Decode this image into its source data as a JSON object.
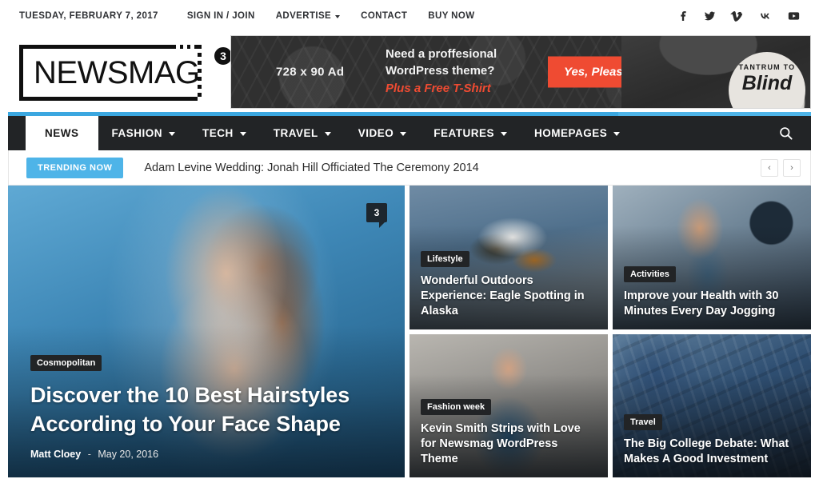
{
  "topbar": {
    "date": "TUESDAY, FEBRUARY 7, 2017",
    "menu": [
      {
        "label": "SIGN IN / JOIN",
        "has_caret": false
      },
      {
        "label": "ADVERTISE",
        "has_caret": true
      },
      {
        "label": "CONTACT",
        "has_caret": false
      },
      {
        "label": "BUY NOW",
        "has_caret": false
      }
    ],
    "social": [
      {
        "name": "facebook-icon"
      },
      {
        "name": "twitter-icon"
      },
      {
        "name": "vimeo-icon"
      },
      {
        "name": "vk-icon"
      },
      {
        "name": "youtube-icon"
      }
    ]
  },
  "logo": {
    "text": "NEWSMAG",
    "badge": "3"
  },
  "ad": {
    "size_label": "728 x 90 Ad",
    "line1": "Need a proffesional",
    "line2": "WordPress theme?",
    "line3": "Plus a Free T-Shirt",
    "cta": "Yes, Please",
    "shirt_line1": "TANTRUM TO",
    "shirt_line2": "Blind",
    "accent_color": "#ef4b32"
  },
  "nav": {
    "items": [
      {
        "label": "NEWS",
        "has_caret": false,
        "active": true
      },
      {
        "label": "FASHION",
        "has_caret": true,
        "active": false
      },
      {
        "label": "TECH",
        "has_caret": true,
        "active": false
      },
      {
        "label": "TRAVEL",
        "has_caret": true,
        "active": false
      },
      {
        "label": "VIDEO",
        "has_caret": true,
        "active": false
      },
      {
        "label": "FEATURES",
        "has_caret": true,
        "active": false
      },
      {
        "label": "HOMEPAGES",
        "has_caret": true,
        "active": false
      }
    ],
    "search_icon": "search-icon",
    "accent_color": "#4eb4e8",
    "bar_color": "#222426"
  },
  "trending": {
    "badge": "TRENDING NOW",
    "headline": "Adam Levine Wedding: Jonah Hill Officiated The Ceremony 2014",
    "prev": "‹",
    "next": "›"
  },
  "hero": {
    "category": "Cosmopolitan",
    "title": "Discover the 10 Best Hairstyles According to Your Face Shape",
    "author": "Matt Cloey",
    "separator": "-",
    "date": "May 20, 2016",
    "comment_count": "3"
  },
  "cards": [
    {
      "category": "Lifestyle",
      "title": "Wonderful Outdoors Experience: Eagle Spotting in Alaska",
      "image": "eagle-photo"
    },
    {
      "category": "Activities",
      "title": "Improve your Health with 30 Minutes Every Day Jogging",
      "image": "jogging-photo"
    },
    {
      "category": "Fashion week",
      "title": "Kevin Smith Strips with Love for Newsmag WordPress Theme",
      "image": "kevin-smith-photo"
    },
    {
      "category": "Travel",
      "title": "The Big College Debate: What Makes A Good Investment",
      "image": "skyscraper-photo"
    }
  ]
}
